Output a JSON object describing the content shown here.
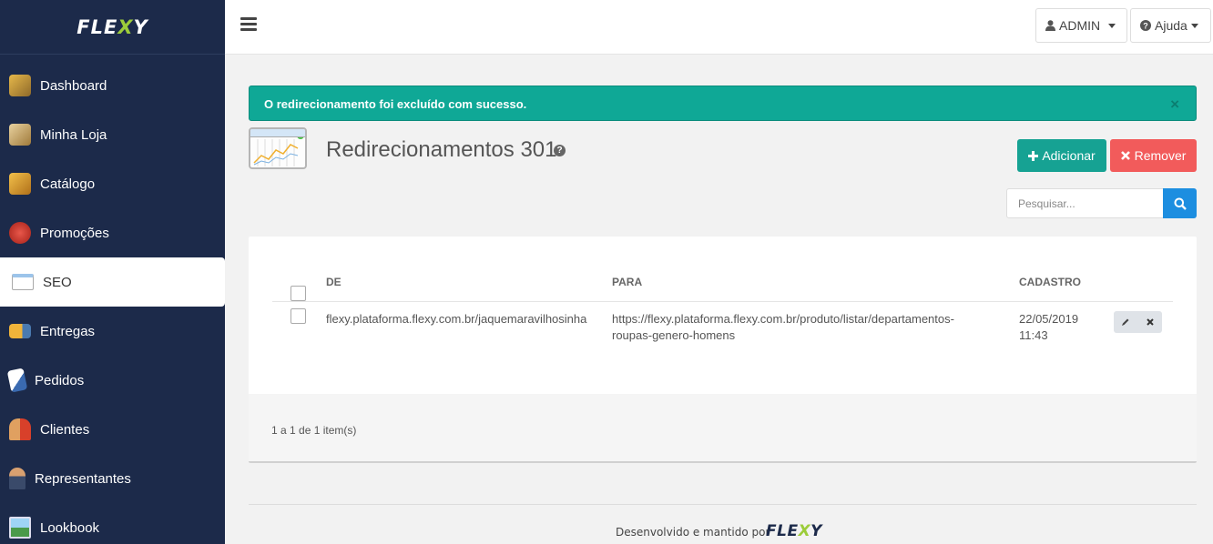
{
  "app": {
    "logo_pre": "FLE",
    "logo_x": "X",
    "logo_post": "Y"
  },
  "sidebar": {
    "items": [
      {
        "label": "Dashboard",
        "icon": "dashboard-icon",
        "color": "#d9a13a"
      },
      {
        "label": "Minha Loja",
        "icon": "store-icon",
        "color": "#c9a25a"
      },
      {
        "label": "Catálogo",
        "icon": "catalog-box-icon",
        "color": "#d8902a"
      },
      {
        "label": "Promoções",
        "icon": "promotion-percent-icon",
        "color": "#d2352b"
      },
      {
        "label": "SEO",
        "icon": "seo-chart-icon",
        "color": "#7ab2e0"
      },
      {
        "label": "Entregas",
        "icon": "delivery-truck-icon",
        "color": "#e0a12b"
      },
      {
        "label": "Pedidos",
        "icon": "orders-document-icon",
        "color": "#5b8ed6"
      },
      {
        "label": "Clientes",
        "icon": "clients-people-icon",
        "color": "#d8462e"
      },
      {
        "label": "Representantes",
        "icon": "representative-person-icon",
        "color": "#c98a5a"
      },
      {
        "label": "Lookbook",
        "icon": "lookbook-image-icon",
        "color": "#5aa6e0"
      }
    ],
    "active_index": 4
  },
  "topbar": {
    "user_label": "ADMIN",
    "help_label": "Ajuda"
  },
  "alert": {
    "message": "O redirecionamento foi excluído com sucesso.",
    "close": "×"
  },
  "page": {
    "title": "Redirecionamentos 301",
    "help": "?"
  },
  "actions": {
    "add_label": "Adicionar",
    "remove_label": "Remover"
  },
  "search": {
    "placeholder": "Pesquisar..."
  },
  "table": {
    "headers": {
      "de": "DE",
      "para": "PARA",
      "cadastro": "CADASTRO"
    },
    "rows": [
      {
        "de": "flexy.plataforma.flexy.com.br/jaquemaravilhosinha",
        "para_line1": "https://flexy.plataforma.flexy.com.br/produto/listar/departamentos-",
        "para_line2": "roupas-genero-homens",
        "date": "22/05/2019",
        "time": "11:43"
      }
    ],
    "pagination": "1 a 1 de 1 item(s)"
  },
  "footer": {
    "text": "Desenvolvido e mantido por",
    "logo_pre": "FLE",
    "logo_x": "X",
    "logo_post": "Y"
  },
  "colors": {
    "sidebar_bg": "#1c2a4a",
    "success": "#0fa896",
    "add": "#16a293",
    "remove": "#f25b5b",
    "search": "#1d8ee0"
  }
}
